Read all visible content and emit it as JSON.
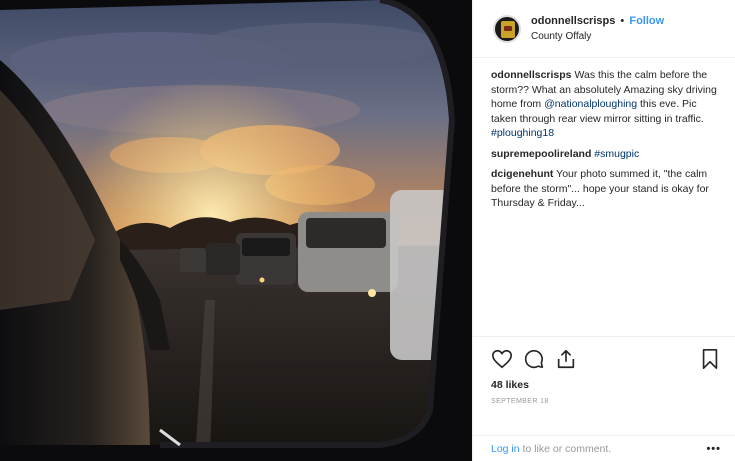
{
  "header": {
    "username": "odonnellscrisps",
    "separator": "•",
    "follow_label": "Follow",
    "location": "County Offaly"
  },
  "caption": {
    "user": "odonnellscrisps",
    "text_before_mention": "Was this the calm before the storm?? What an absolutely Amazing sky driving home from",
    "mention": "@nationalploughing",
    "text_after_mention": "this eve. Pic taken through rear view mirror sitting in traffic.",
    "hashtag": "#ploughing18"
  },
  "comments": [
    {
      "user": "supremepoolireland",
      "text": "",
      "hashtag": "#smugpic"
    },
    {
      "user": "dcigenehunt",
      "text": "Your photo summed it, \"the calm before the storm\"... hope your stand is okay for Thursday & Friday...",
      "hashtag": ""
    }
  ],
  "actions": {
    "icons": [
      "heart-icon",
      "comment-icon",
      "share-icon",
      "bookmark-icon"
    ],
    "likes": "48 likes",
    "date": "SEPTEMBER 18"
  },
  "footer": {
    "login_label": "Log in",
    "login_suffix": "to like or comment.",
    "more_label": "•••"
  },
  "colors": {
    "accent": "#3897f0",
    "link": "#003569",
    "muted": "#999999"
  }
}
